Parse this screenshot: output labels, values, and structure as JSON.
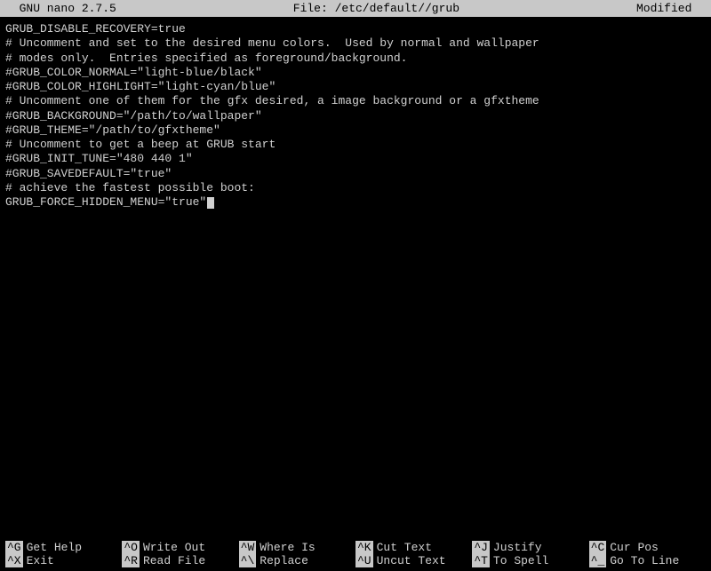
{
  "titlebar": {
    "app": "  GNU nano 2.7.5",
    "file": "File: /etc/default//grub",
    "status": "Modified  "
  },
  "lines": [
    "GRUB_DISABLE_RECOVERY=true",
    "",
    "# Uncomment and set to the desired menu colors.  Used by normal and wallpaper",
    "# modes only.  Entries specified as foreground/background.",
    "#GRUB_COLOR_NORMAL=\"light-blue/black\"",
    "#GRUB_COLOR_HIGHLIGHT=\"light-cyan/blue\"",
    "",
    "# Uncomment one of them for the gfx desired, a image background or a gfxtheme",
    "#GRUB_BACKGROUND=\"/path/to/wallpaper\"",
    "#GRUB_THEME=\"/path/to/gfxtheme\"",
    "",
    "# Uncomment to get a beep at GRUB start",
    "#GRUB_INIT_TUNE=\"480 440 1\"",
    "",
    "#GRUB_SAVEDEFAULT=\"true\"",
    "# achieve the fastest possible boot:",
    "GRUB_FORCE_HIDDEN_MENU=\"true\""
  ],
  "cursor_line": 16,
  "help": {
    "row1": [
      {
        "key": "^G",
        "label": "Get Help"
      },
      {
        "key": "^O",
        "label": "Write Out"
      },
      {
        "key": "^W",
        "label": "Where Is"
      },
      {
        "key": "^K",
        "label": "Cut Text"
      },
      {
        "key": "^J",
        "label": "Justify"
      },
      {
        "key": "^C",
        "label": "Cur Pos"
      }
    ],
    "row2": [
      {
        "key": "^X",
        "label": "Exit"
      },
      {
        "key": "^R",
        "label": "Read File"
      },
      {
        "key": "^\\",
        "label": "Replace"
      },
      {
        "key": "^U",
        "label": "Uncut Text"
      },
      {
        "key": "^T",
        "label": "To Spell"
      },
      {
        "key": "^_",
        "label": "Go To Line"
      }
    ]
  }
}
